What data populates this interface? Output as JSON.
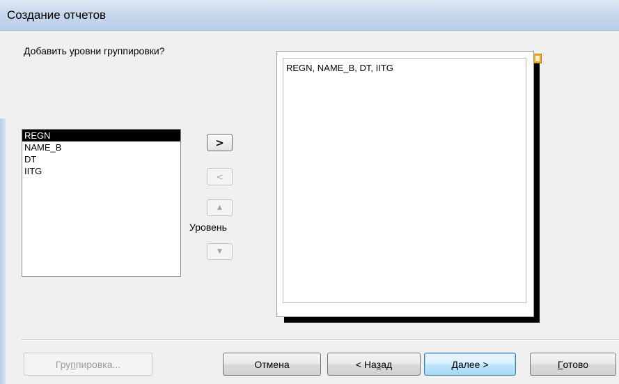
{
  "window": {
    "title": "Создание отчетов"
  },
  "prompt": "Добавить уровни группировки?",
  "fields_list": {
    "items": [
      {
        "label": "REGN",
        "selected": true
      },
      {
        "label": "NAME_B",
        "selected": false
      },
      {
        "label": "DT",
        "selected": false
      },
      {
        "label": "IITG",
        "selected": false
      }
    ]
  },
  "move_buttons": {
    "add": ">",
    "remove": "<",
    "up": "▲",
    "down": "▼"
  },
  "level_label": "Уровень",
  "preview": {
    "text": "REGN, NAME_B, DT, IITG"
  },
  "footer": {
    "grouping": {
      "pre": "Гру",
      "accel": "п",
      "post": "пировка..."
    },
    "cancel": "Отмена",
    "back": {
      "pre": "< На",
      "accel": "з",
      "post": "ад"
    },
    "next": {
      "pre": "",
      "accel": "Д",
      "post": "алее >"
    },
    "finish": {
      "pre": "",
      "accel": "Г",
      "post": "отово"
    }
  },
  "colors": {
    "title_bar": "#c7d8ec",
    "selected_item": "#000000",
    "default_button": "#a7d9f5"
  }
}
